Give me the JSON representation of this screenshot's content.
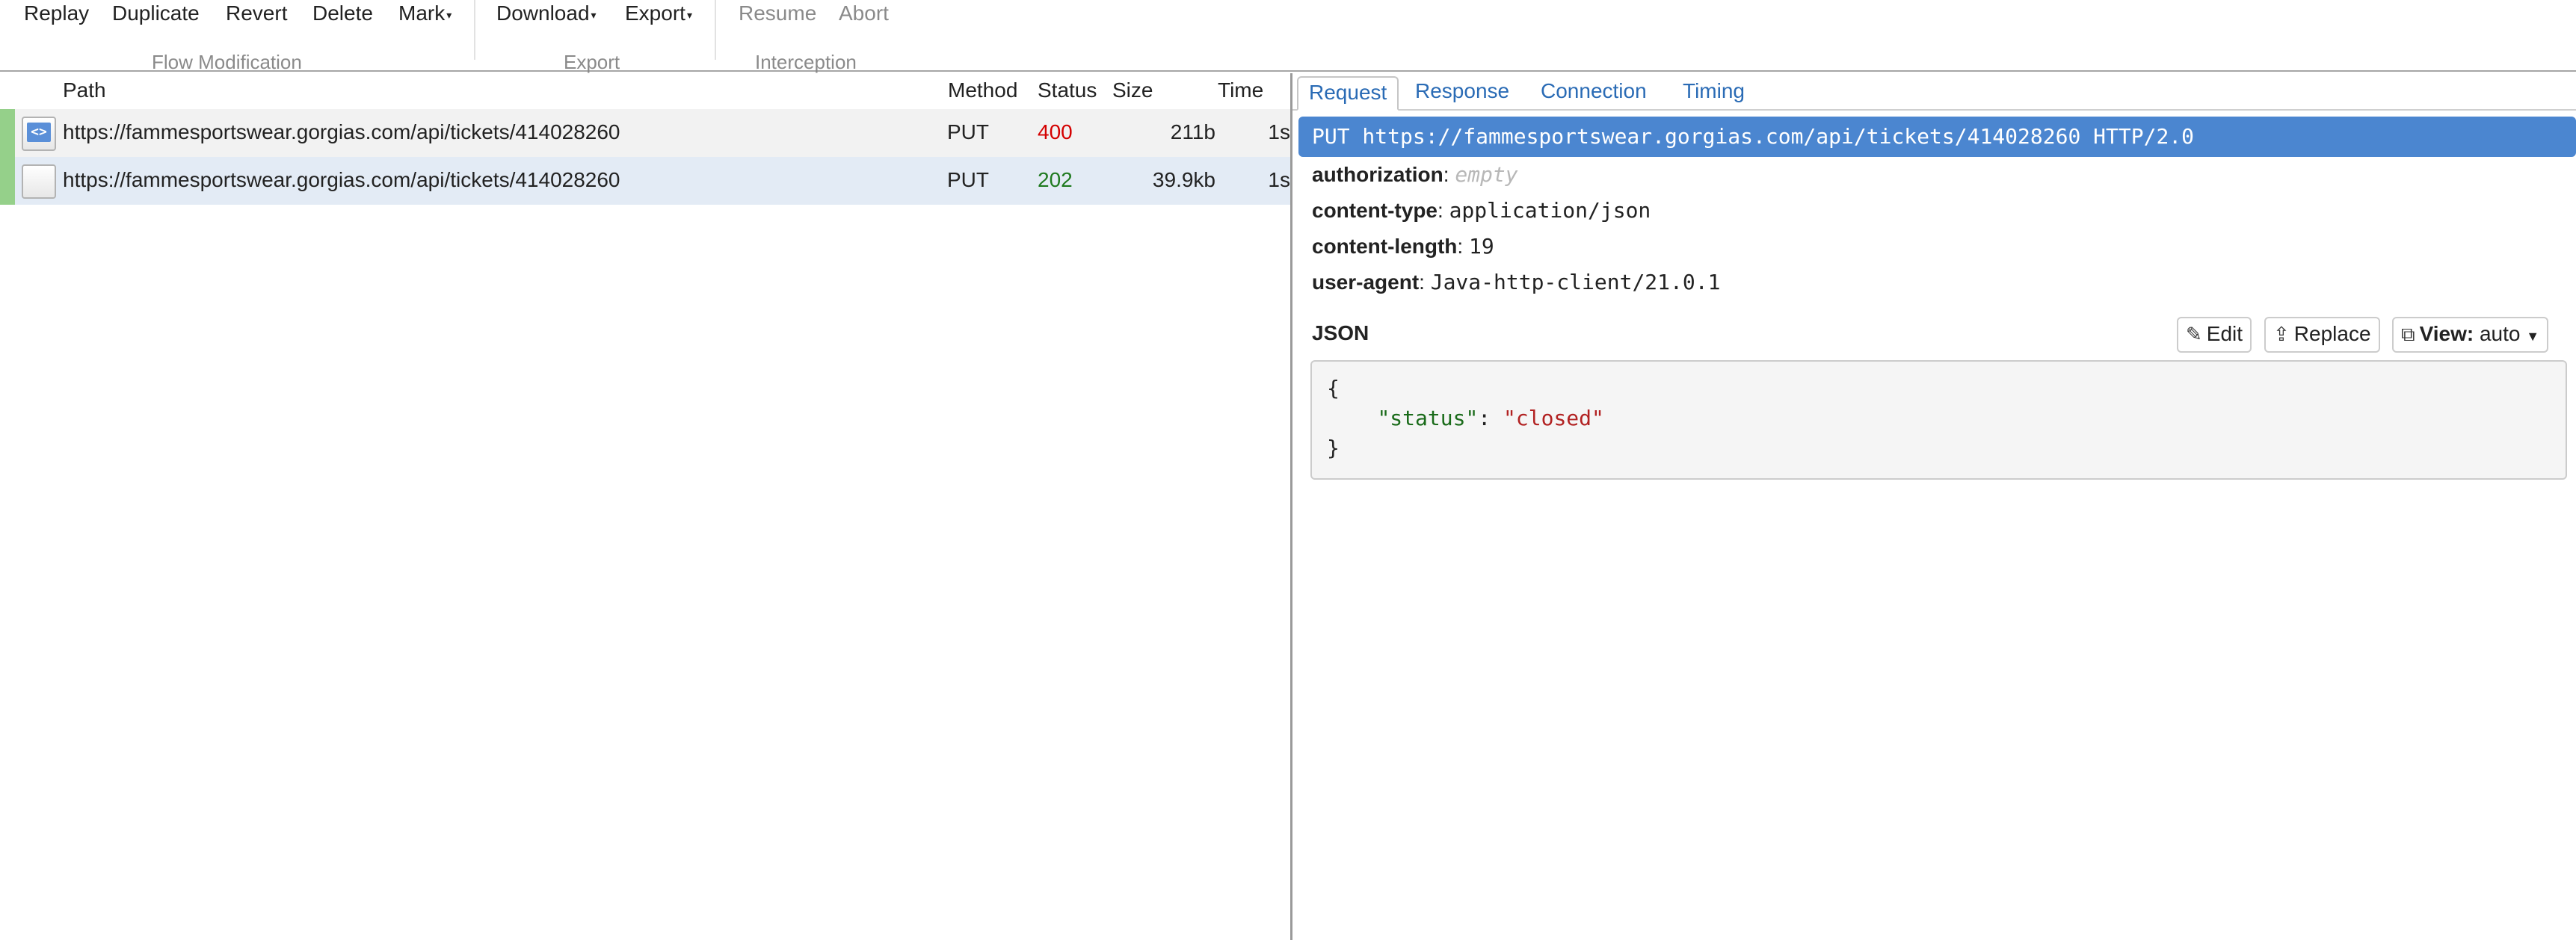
{
  "toolbar": {
    "flow_modification": {
      "title": "Flow Modification",
      "replay": "Replay",
      "duplicate": "Duplicate",
      "revert": "Revert",
      "delete": "Delete",
      "mark": "Mark"
    },
    "export": {
      "title": "Export",
      "download": "Download",
      "export": "Export"
    },
    "interception": {
      "title": "Interception",
      "resume": "Resume",
      "abort": "Abort"
    }
  },
  "flow_table": {
    "headers": {
      "path": "Path",
      "method": "Method",
      "status": "Status",
      "size": "Size",
      "time": "Time"
    },
    "rows": [
      {
        "path": "https://fammesportswear.gorgias.com/api/tickets/414028260",
        "method": "PUT",
        "status": "400",
        "size": "211b",
        "time": "1s",
        "icon": "html-document-icon",
        "status_color": "#d40000"
      },
      {
        "path": "https://fammesportswear.gorgias.com/api/tickets/414028260",
        "method": "PUT",
        "status": "202",
        "size": "39.9kb",
        "time": "1s",
        "icon": "blank-document-icon",
        "status_color": "#1f7a1f",
        "selected": true
      }
    ]
  },
  "detail": {
    "tabs": [
      "Request",
      "Response",
      "Connection",
      "Timing"
    ],
    "active_tab": "Request",
    "request_line": "PUT https://fammesportswear.gorgias.com/api/tickets/414028260 HTTP/2.0",
    "headers": [
      {
        "name": "authorization",
        "value": "empty",
        "is_empty": true
      },
      {
        "name": "content-type",
        "value": "application/json"
      },
      {
        "name": "content-length",
        "value": "19"
      },
      {
        "name": "user-agent",
        "value": "Java-http-client/21.0.1"
      }
    ],
    "body": {
      "format_label": "JSON",
      "edit_label": "Edit",
      "replace_label": "Replace",
      "view_label": "View:",
      "view_value": "auto",
      "json_open": "{",
      "json_key": "\"status\"",
      "json_value": "\"closed\"",
      "json_close": "}"
    }
  },
  "colors": {
    "accent": "#4b86d0",
    "link": "#2a6bb5",
    "marker": "#95d08a",
    "selected_row": "#e3ebf5",
    "status_error": "#d40000",
    "status_ok": "#1f7a1f"
  }
}
